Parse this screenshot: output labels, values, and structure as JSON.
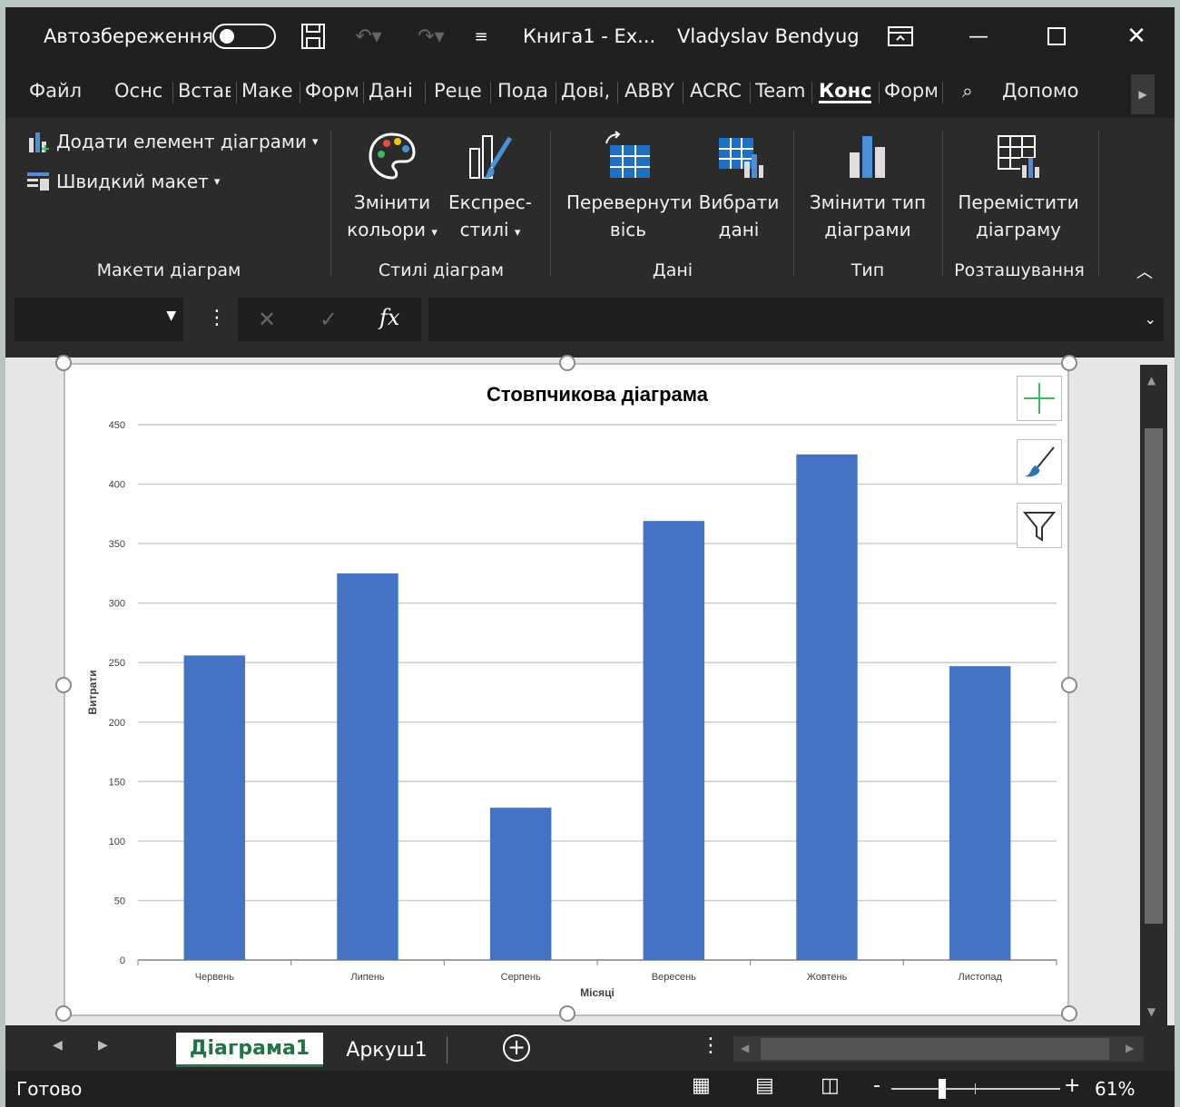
{
  "titlebar": {
    "autosave_label": "Автозбереження",
    "doc_title": "Книга1  -  Ex...",
    "user": "Vladyslav Bendyug"
  },
  "menu": {
    "tabs": [
      {
        "label": "Файл"
      },
      {
        "label": "Оснс"
      },
      {
        "label": "Встав"
      },
      {
        "label": "Маке"
      },
      {
        "label": "Форм"
      },
      {
        "label": "Дані"
      },
      {
        "label": "Реце"
      },
      {
        "label": "Пода"
      },
      {
        "label": "Дові,"
      },
      {
        "label": "ABBY"
      },
      {
        "label": "ACRC"
      },
      {
        "label": "Team"
      },
      {
        "label": "Конс"
      },
      {
        "label": "Форм"
      }
    ],
    "help": "Допомо"
  },
  "ribbon": {
    "add_element": "Додати елемент діаграми",
    "quick_layout": "Швидкий макет",
    "change_colors_1": "Змінити",
    "change_colors_2": "кольори",
    "express_1": "Експрес-",
    "express_2": "стилі",
    "flip_1": "Перевернути",
    "flip_2": "вісь",
    "select_1": "Вибрати",
    "select_2": "дані",
    "change_type_1": "Змінити тип",
    "change_type_2": "діаграми",
    "move_1": "Перемістити",
    "move_2": "діаграму",
    "groups": {
      "layouts": "Макети діаграм",
      "styles": "Стилі діаграм",
      "data": "Дані",
      "type": "Тип",
      "location": "Розташування"
    }
  },
  "formula": {
    "fx": "fx",
    "cancel": "✕",
    "enter": "✓"
  },
  "chart_data": {
    "type": "bar",
    "title": "Стовпчикова діаграма",
    "xlabel": "Місяці",
    "ylabel": "Витрати",
    "categories": [
      "Червень",
      "Липень",
      "Серпень",
      "Вересень",
      "Жовтень",
      "Листопад"
    ],
    "values": [
      256,
      325,
      128,
      369,
      425,
      247
    ],
    "ylim": [
      0,
      450
    ],
    "yticks": [
      "0",
      "50",
      "100",
      "150",
      "200",
      "250",
      "300",
      "350",
      "400",
      "450"
    ],
    "bar_color": "#4472C4",
    "grid": true
  },
  "sheets": {
    "tabs": [
      {
        "label": "Діаграма1"
      },
      {
        "label": "Аркуш1"
      }
    ]
  },
  "status": {
    "ready": "Готово",
    "zoom": "61%"
  },
  "colors": {
    "accent_green": "#217346",
    "chart_blue": "#4472C4"
  }
}
